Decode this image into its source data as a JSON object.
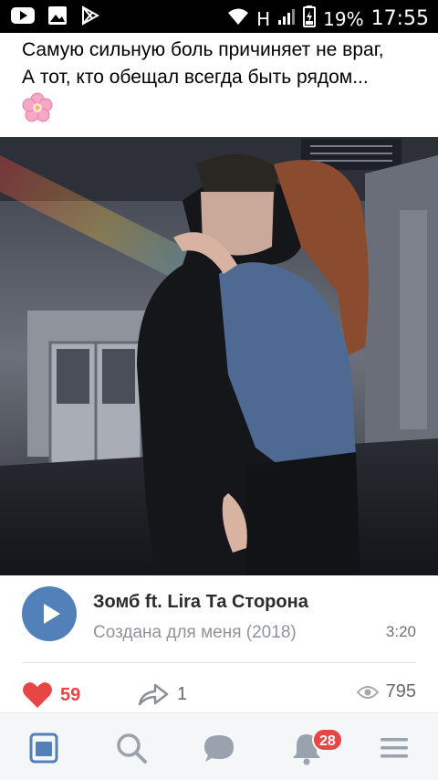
{
  "status_bar": {
    "network": "H",
    "battery": "19%",
    "time": "17:55",
    "icons": [
      "youtube-icon",
      "gallery-icon",
      "play-store-icon",
      "wifi-icon",
      "signal-icon",
      "battery-icon"
    ]
  },
  "post": {
    "text_line1": "Самую сильную боль причиняет не враг,",
    "text_line2": "А тот, кто обещал всегда быть рядом...",
    "emoji": "cherry-blossom-icon"
  },
  "audio": {
    "title": "Зомб ft. Lira Та Сторона",
    "album": "Создана для меня (2018)",
    "duration": "3:20"
  },
  "actions": {
    "likes": "59",
    "shares": "1",
    "views": "795"
  },
  "nav": {
    "items": [
      "feed-icon",
      "search-icon",
      "messages-icon",
      "notifications-icon",
      "menu-icon"
    ],
    "notifications_badge": "28"
  },
  "colors": {
    "accent": "#5181b8",
    "like": "#e64646",
    "text_secondary": "#909399"
  }
}
